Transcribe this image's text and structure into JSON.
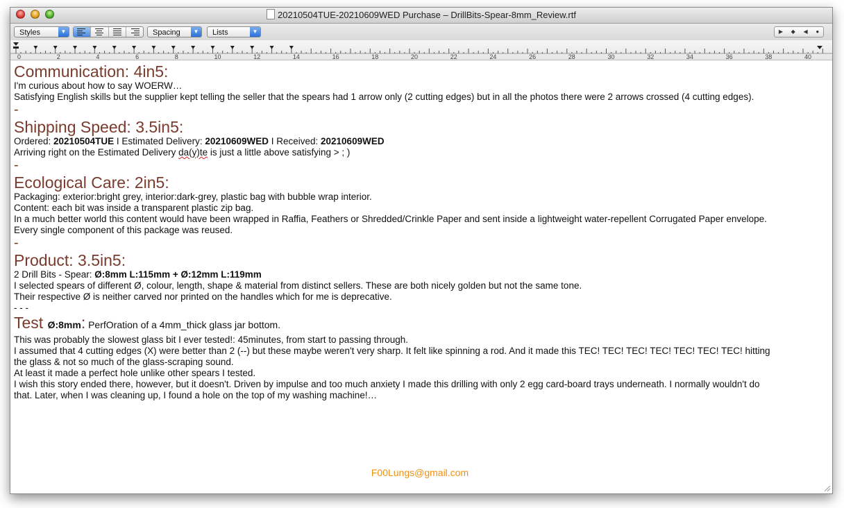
{
  "window": {
    "title": "20210504TUE-20210609WED Purchase – DrillBits-Spear-8mm_Review.rtf",
    "doc_icon": "document-icon"
  },
  "toolbar": {
    "styles_label": "Styles",
    "spacing_label": "Spacing",
    "lists_label": "Lists",
    "align_options": [
      "align-left",
      "align-center",
      "align-justify",
      "align-right"
    ],
    "nav_glyphs": [
      "▶",
      "◆",
      "◀",
      "●"
    ]
  },
  "ruler": {
    "labels": [
      "0",
      "2",
      "4",
      "6",
      "8",
      "10",
      "12",
      "14",
      "16",
      "18",
      "20",
      "22",
      "24",
      "26",
      "28",
      "30",
      "32",
      "34",
      "36",
      "38",
      "40"
    ]
  },
  "doc": {
    "communication": {
      "heading": "Communication: 4in5:",
      "line1": "I'm curious about how to say WOERW…",
      "line2": "Satisfying English skills but the supplier kept telling the seller that the spears had 1 arrow only (2 cutting edges) but in all the photos there were 2 arrows crossed (4 cutting edges)."
    },
    "dash": "-",
    "shipping": {
      "heading": "Shipping Speed: 3.5in5:",
      "ordered_label": "Ordered: ",
      "ordered_value": "20210504TUE",
      "sep1": " I Estimated Delivery: ",
      "estimated_value": "20210609WED",
      "sep2": " I Received: ",
      "received_value": "20210609WED",
      "line2_pre": "Arriving right on the Estimated Delivery ",
      "line2_typo": "da(y)te",
      "line2_post": " is just a little above satisfying >  ; )"
    },
    "ecological": {
      "heading": "Ecological Care: 2in5:",
      "line1": "Packaging: exterior:bright grey, interior:dark-grey, plastic bag with bubble wrap interior.",
      "line2": "Content: each bit was inside a transparent plastic zip bag.",
      "line3": "In a much better world this content would have been wrapped in Raffia, Feathers or Shredded/Crinkle Paper and sent inside a lightweight water-repellent Corrugated Paper envelope.",
      "line4": "Every single component of this package was reused."
    },
    "product": {
      "heading": "Product: 3.5in5:",
      "line1_pre": "2 Drill Bits - Spear: ",
      "line1_spec": "Ø:8mm L:115mm + Ø:12mm L:119mm",
      "line2": "I selected spears of different Ø, colour, length, shape & material from distinct sellers. These are both nicely golden but not the same tone.",
      "line3": "Their respective Ø is neither carved nor printed on the handles which for me is deprecative.",
      "separator": "- - -"
    },
    "test": {
      "heading": "Test ",
      "spec": "Ø:8mm",
      "colon": ":",
      "desc": " PerfOration of a 4mm_thick glass jar bottom.",
      "line1": "This was probably the slowest glass bit I ever tested!: 45minutes, from start to passing through.",
      "line2": "I assumed that 4 cutting edges (X) were better than 2 (--) but these maybe weren't very sharp. It felt like spinning a rod. And it made this TEC! TEC! TEC! TEC! TEC! TEC! TEC! hitting",
      "line3": "the glass & not so much of the glass-scraping sound.",
      "line4": "At least it made a perfect hole unlike other spears I tested.",
      "line5": "I wish this story ended there, however, but it doesn't. Driven by impulse and too much anxiety I made this drilling with only 2 egg card-board trays underneath. I normally wouldn't do",
      "line6": "that. Later, when I was cleaning up, I found a hole on the top of my washing machine!…"
    },
    "email": "F00Lungs@gmail.com"
  }
}
